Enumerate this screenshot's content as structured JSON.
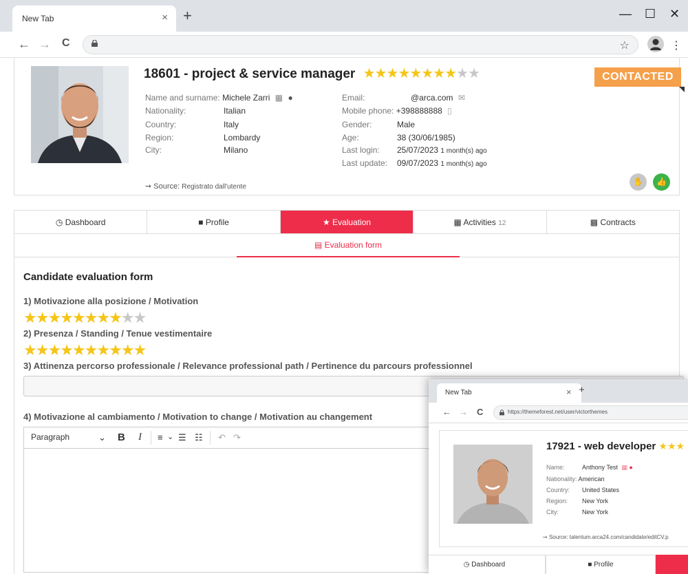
{
  "browser": {
    "tab_title": "New Tab",
    "tab_close": "×",
    "new_tab": "+",
    "win_min": "—",
    "win_max": "☐",
    "win_close": "✕",
    "back": "←",
    "forward": "→",
    "reload": "C",
    "bookmark": "☆",
    "menu": "⋮"
  },
  "candidate": {
    "title": "18601 - project & service manager",
    "rating": 8,
    "rating_max": 10,
    "name_label": "Name and surname:",
    "name_value": "Michele Zarri",
    "nationality_label": "Nationality:",
    "nationality_value": "Italian",
    "country_label": "Country:",
    "country_value": "Italy",
    "region_label": "Region:",
    "region_value": "Lombardy",
    "city_label": "City:",
    "city_value": "Milano",
    "email_label": "Email:",
    "email_value": "@arca.com",
    "mobile_label": "Mobile phone:",
    "mobile_value": "+398888888",
    "gender_label": "Gender:",
    "gender_value": "Male",
    "age_label": "Age:",
    "age_value": "38 (30/06/1985)",
    "last_login_label": "Last login:",
    "last_login_value": "25/07/2023",
    "last_login_ago": "1 month(s) ago",
    "last_update_label": "Last update:",
    "last_update_value": "09/07/2023",
    "last_update_ago": "1 month(s) ago",
    "status_badge": "CONTACTED",
    "source_label": "Source:",
    "source_value": "Registrato dall'utente"
  },
  "tabs": [
    {
      "icon": "◷",
      "label": "Dashboard",
      "count": ""
    },
    {
      "icon": "■",
      "label": "Profile",
      "count": ""
    },
    {
      "icon": "★",
      "label": "Evaluation",
      "count": ""
    },
    {
      "icon": "▦",
      "label": "Activities",
      "count": "12"
    },
    {
      "icon": "▩",
      "label": "Contracts",
      "count": ""
    }
  ],
  "subtab": {
    "icon": "▤",
    "label": "Evaluation form"
  },
  "form": {
    "title": "Candidate evaluation form",
    "q1": "1) Motivazione alla posizione / Motivation",
    "q1_rating": 8,
    "q2": "2) Presenza / Standing / Tenue vestimentaire",
    "q2_rating": 10,
    "q3": "3) Attinenza percorso professionale / Relevance professional path / Pertinence du parcours professionnel",
    "q4": "4) Motivazione al cambiamento / Motivation to change / Motivation au changement",
    "rating_max": 10
  },
  "editor": {
    "paragraph": "Paragraph",
    "dropdown": "⌄",
    "bold": "B",
    "italic": "I",
    "align": "≡",
    "align_caret": "⌄",
    "bullets": "☰",
    "numbered": "☷",
    "undo": "↶",
    "redo": "↷"
  },
  "overlay": {
    "tab_title": "New Tab",
    "tab_close": "×",
    "new_tab": "+",
    "url": "https://themeforest.net/user/victorthemes",
    "title": "17921 - web developer",
    "name_label": "Name:",
    "name_value": "Anthony Test",
    "nationality_label": "Nationality:",
    "nationality_value": "American",
    "country_label": "Country:",
    "country_value": "United States",
    "region_label": "Region:",
    "region_value": "New York",
    "city_label": "City:",
    "city_value": "New York",
    "source_label": "Source:",
    "source_value": "talentum.arca24.com/candidate/editCV.p",
    "tab_dashboard": "Dashboard",
    "tab_profile": "Profile"
  },
  "colors": {
    "accent": "#ee2d4a",
    "star": "#f5c518",
    "badge": "#f5a04a",
    "thumb_up": "#3cb34a"
  }
}
